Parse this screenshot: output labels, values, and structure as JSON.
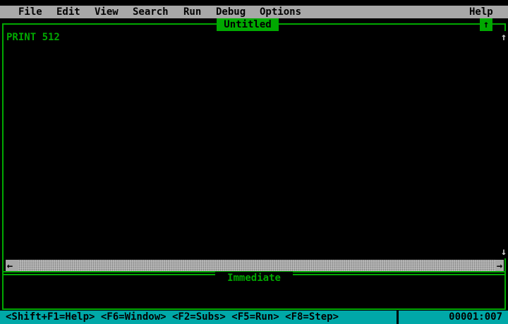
{
  "menu": {
    "file": "File",
    "edit": "Edit",
    "view": "View",
    "search": "Search",
    "run": "Run",
    "debug": "Debug",
    "options": "Options",
    "help": "Help"
  },
  "editor": {
    "title": "Untitled",
    "maximize_glyph": "↑",
    "lines": [
      "PRINT 512"
    ]
  },
  "scrollbars": {
    "up": "↑",
    "down": "↓",
    "left": "←",
    "right": "→"
  },
  "immediate": {
    "title": "Immediate"
  },
  "status": {
    "keys": "<Shift+F1=Help> <F6=Window> <F2=Subs> <F5=Run> <F8=Step>",
    "position": "00001:007"
  },
  "colors": {
    "background": "#000000",
    "menubar": "#a8a8a8",
    "frame": "#00a800",
    "statusbar": "#00a8a8"
  }
}
